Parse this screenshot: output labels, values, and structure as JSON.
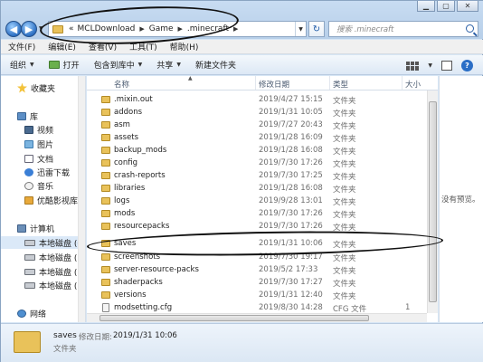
{
  "window": {
    "address": {
      "prefix": "«",
      "crumbs": [
        "MCLDownload",
        "Game",
        ".minecraft"
      ]
    },
    "search_placeholder": "搜索 .minecraft"
  },
  "menu": [
    "文件(F)",
    "编辑(E)",
    "查看(V)",
    "工具(T)",
    "帮助(H)"
  ],
  "toolbar": {
    "organize": "组织",
    "open": "打开",
    "include_in_library": "包含到库中",
    "share": "共享",
    "new_folder": "新建文件夹"
  },
  "nav": {
    "favorites": "收藏夹",
    "library": "库",
    "videos": "视频",
    "pictures": "图片",
    "documents": "文档",
    "thunder": "迅雷下载",
    "music": "音乐",
    "youku": "优酷影视库",
    "computer": "计算机",
    "drives": [
      "本地磁盘 (C",
      "本地磁盘 (D",
      "本地磁盘 (E",
      "本地磁盘 (F"
    ],
    "network": "网络"
  },
  "columns": {
    "name": "名称",
    "date": "修改日期",
    "type": "类型",
    "size": "大小"
  },
  "files": [
    {
      "name": ".mixin.out",
      "date": "2019/4/27 15:15",
      "type": "文件夹",
      "size": ""
    },
    {
      "name": "addons",
      "date": "2019/1/31 10:05",
      "type": "文件夹",
      "size": ""
    },
    {
      "name": "asm",
      "date": "2019/7/27 20:43",
      "type": "文件夹",
      "size": ""
    },
    {
      "name": "assets",
      "date": "2019/1/28 16:09",
      "type": "文件夹",
      "size": ""
    },
    {
      "name": "backup_mods",
      "date": "2019/1/28 16:08",
      "type": "文件夹",
      "size": ""
    },
    {
      "name": "config",
      "date": "2019/7/30 17:26",
      "type": "文件夹",
      "size": ""
    },
    {
      "name": "crash-reports",
      "date": "2019/7/30 17:25",
      "type": "文件夹",
      "size": ""
    },
    {
      "name": "libraries",
      "date": "2019/1/28 16:08",
      "type": "文件夹",
      "size": ""
    },
    {
      "name": "logs",
      "date": "2019/9/28 13:01",
      "type": "文件夹",
      "size": ""
    },
    {
      "name": "mods",
      "date": "2019/7/30 17:26",
      "type": "文件夹",
      "size": ""
    },
    {
      "name": "resourcepacks",
      "date": "2019/7/30 17:26",
      "type": "文件夹",
      "size": ""
    },
    {
      "name": "saves",
      "date": "2019/1/31 10:06",
      "type": "文件夹",
      "size": ""
    },
    {
      "name": "screenshots",
      "date": "2019/7/30 19:17",
      "type": "文件夹",
      "size": ""
    },
    {
      "name": "server-resource-packs",
      "date": "2019/5/2 17:33",
      "type": "文件夹",
      "size": ""
    },
    {
      "name": "shaderpacks",
      "date": "2019/7/30 17:27",
      "type": "文件夹",
      "size": ""
    },
    {
      "name": "versions",
      "date": "2019/1/31 12:40",
      "type": "文件夹",
      "size": ""
    },
    {
      "name": "modsetting.cfg",
      "date": "2019/8/30 14:28",
      "type": "CFG 文件",
      "size": "1"
    }
  ],
  "preview": {
    "empty_text": "没有预览。"
  },
  "details": {
    "name": "saves",
    "modified_label": "修改日期:",
    "modified_value": "2019/1/31 10:06",
    "type": "文件夹"
  }
}
